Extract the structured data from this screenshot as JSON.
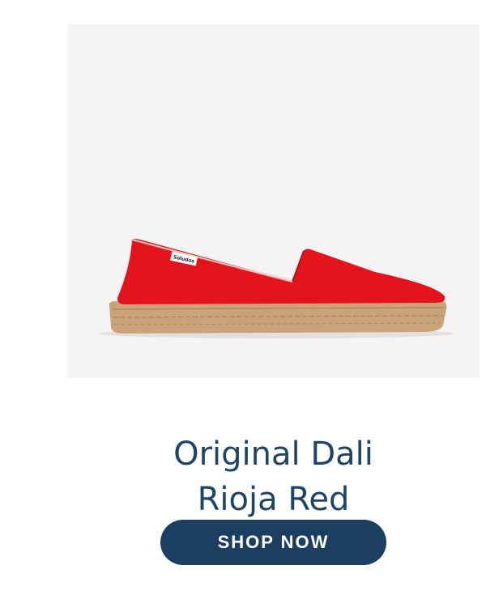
{
  "product": {
    "image_alt": "Red espadrille shoe",
    "brand_tag": "Soludos",
    "title_line1": "Original Dali",
    "title_line2": "Rioja Red",
    "shoe_color": "#e3141b",
    "jute_color": "#c9a478"
  },
  "cta": {
    "label": "SHOP NOW",
    "color": "#1c3f61"
  }
}
